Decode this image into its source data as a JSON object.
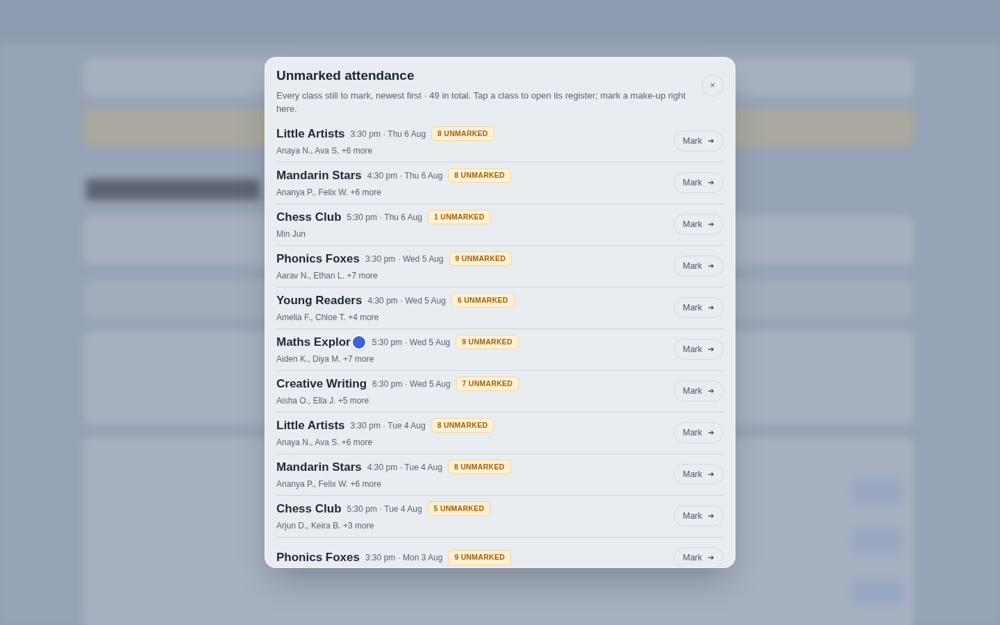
{
  "dialog": {
    "title": "Unmarked attendance",
    "close": "×",
    "description": "Every class still to mark, newest first · 49 in total. Tap a class to open its register; mark a make-up right here.",
    "classes": [
      {
        "name": "Little Artists",
        "time": "3:30 pm · Thu 6 Aug",
        "badge": "8 UNMARKED",
        "students": "Anaya N., Ava S. +6 more",
        "action": "Mark",
        "touched": false
      },
      {
        "name": "Mandarin Stars",
        "time": "4:30 pm · Thu 6 Aug",
        "badge": "8 UNMARKED",
        "students": "Ananya P., Felix W. +6 more",
        "action": "Mark",
        "touched": false
      },
      {
        "name": "Chess Club",
        "time": "5:30 pm · Thu 6 Aug",
        "badge": "1 UNMARKED",
        "students": "Min Jun",
        "action": "Mark",
        "touched": false
      },
      {
        "name": "Phonics Foxes",
        "time": "3:30 pm · Wed 5 Aug",
        "badge": "9 UNMARKED",
        "students": "Aarav N., Ethan L. +7 more",
        "action": "Mark",
        "touched": false
      },
      {
        "name": "Young Readers",
        "time": "4:30 pm · Wed 5 Aug",
        "badge": "6 UNMARKED",
        "students": "Amelia F., Chloe T. +4 more",
        "action": "Mark",
        "touched": false
      },
      {
        "name": "Maths Explor",
        "time": "5:30 pm · Wed 5 Aug",
        "badge": "9 UNMARKED",
        "students": "Aiden K., Diya M. +7 more",
        "action": "Mark",
        "touched": true
      },
      {
        "name": "Creative Writing",
        "time": "6:30 pm · Wed 5 Aug",
        "badge": "7 UNMARKED",
        "students": "Aisha O., Ella J. +5 more",
        "action": "Mark",
        "touched": false
      },
      {
        "name": "Little Artists",
        "time": "3:30 pm · Tue 4 Aug",
        "badge": "8 UNMARKED",
        "students": "Anaya N., Ava S. +6 more",
        "action": "Mark",
        "touched": false
      },
      {
        "name": "Mandarin Stars",
        "time": "4:30 pm · Tue 4 Aug",
        "badge": "8 UNMARKED",
        "students": "Ananya P., Felix W. +6 more",
        "action": "Mark",
        "touched": false
      },
      {
        "name": "Chess Club",
        "time": "5:30 pm · Tue 4 Aug",
        "badge": "5 UNMARKED",
        "students": "Arjun D., Keira B. +3 more",
        "action": "Mark",
        "touched": false
      },
      {
        "name": "Phonics Foxes",
        "time": "3:30 pm · Mon 3 Aug",
        "badge": "9 UNMARKED",
        "action": "Mark",
        "touched": false
      }
    ]
  }
}
